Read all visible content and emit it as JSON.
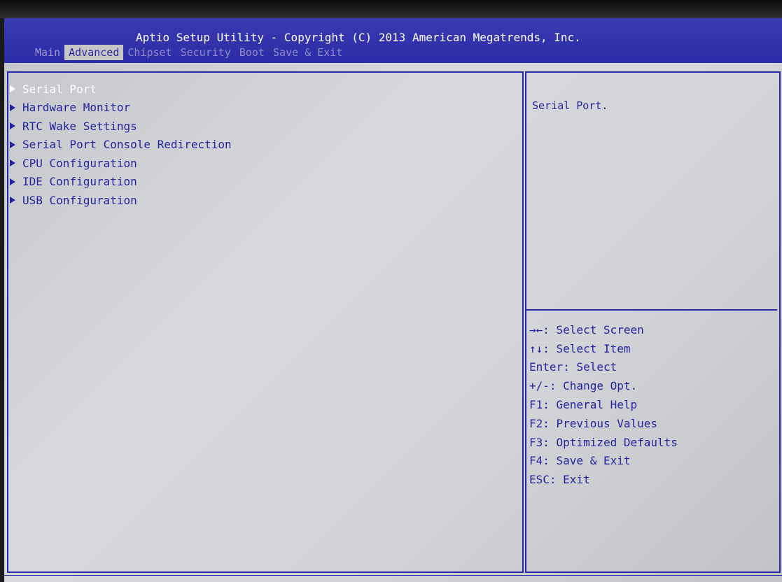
{
  "title": "Aptio Setup Utility - Copyright (C) 2013 American Megatrends, Inc.",
  "tabs": [
    {
      "label": "Main"
    },
    {
      "label": "Advanced"
    },
    {
      "label": "Chipset"
    },
    {
      "label": "Security"
    },
    {
      "label": "Boot"
    },
    {
      "label": "Save & Exit"
    }
  ],
  "menu": {
    "items": [
      {
        "label": "Serial Port"
      },
      {
        "label": "Hardware Monitor"
      },
      {
        "label": "RTC Wake Settings"
      },
      {
        "label": "Serial Port Console Redirection"
      },
      {
        "label": "CPU Configuration"
      },
      {
        "label": "IDE Configuration"
      },
      {
        "label": "USB Configuration"
      }
    ],
    "selected": "Serial Port"
  },
  "help": {
    "text": "Serial Port."
  },
  "keys": [
    {
      "label": "→←: Select Screen"
    },
    {
      "label": "↑↓: Select Item"
    },
    {
      "label": "Enter: Select"
    },
    {
      "label": "+/-: Change Opt."
    },
    {
      "label": "F1: General Help"
    },
    {
      "label": "F2: Previous Values"
    },
    {
      "label": "F3: Optimized Defaults"
    },
    {
      "label": "F4: Save & Exit"
    },
    {
      "label": "ESC: Exit"
    }
  ],
  "colors": {
    "header_bg": "#2c2ca8",
    "screen_bg": "#d0d2d6",
    "text": "#2424a0",
    "selected_text": "#ffffff",
    "active_tab_bg": "#c6c6c6"
  }
}
